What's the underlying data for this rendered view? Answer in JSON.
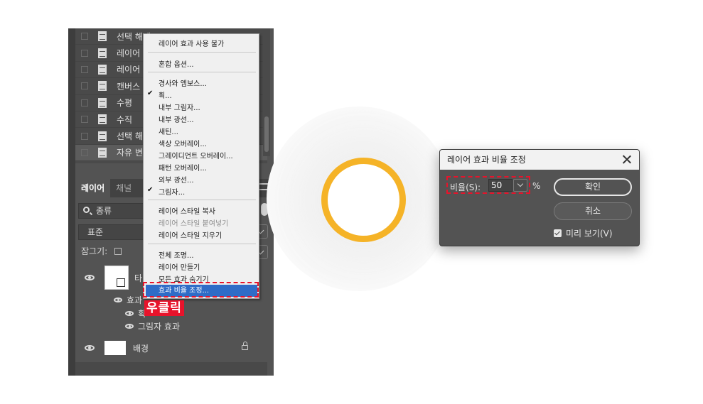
{
  "history": {
    "items": [
      "선택 해제",
      "레이어",
      "레이어",
      "캔버스",
      "수평",
      "수직",
      "선택 해",
      "자유 변"
    ]
  },
  "layers_panel": {
    "tabs": [
      "레이어",
      "채널"
    ],
    "search_label": "종류",
    "blend_mode": "표준",
    "lock_label": "잠그기:",
    "layers": [
      {
        "name": "타",
        "effects_label": "효과",
        "effects": [
          "획",
          "그림자 효과"
        ]
      },
      {
        "name": "배경"
      }
    ]
  },
  "context_menu": {
    "items": [
      {
        "label": "레이어 효과 사용 불가"
      },
      {
        "label": "혼합 옵션..."
      },
      {
        "label": "경사와 엠보스..."
      },
      {
        "label": "획...",
        "checked": true
      },
      {
        "label": "내부 그림자..."
      },
      {
        "label": "내부 광선..."
      },
      {
        "label": "새틴..."
      },
      {
        "label": "색상 오버레이..."
      },
      {
        "label": "그레이디언트 오버레이..."
      },
      {
        "label": "패턴 오버레이..."
      },
      {
        "label": "외부 광선..."
      },
      {
        "label": "그림자...",
        "checked": true
      },
      {
        "label": "레이어 스타일 복사"
      },
      {
        "label": "레이어 스타일 붙여넣기",
        "disabled": true
      },
      {
        "label": "레이어 스타일 지우기"
      },
      {
        "label": "전체 조명..."
      },
      {
        "label": "레이어 만들기"
      },
      {
        "label": "모든 효과 숨기기"
      },
      {
        "label": "효과 비율 조정...",
        "selected": true
      }
    ],
    "check_mark": "✔"
  },
  "annotation": {
    "right_click": "우클릭",
    "color": "#e8132b"
  },
  "dialog": {
    "title": "레이어 효과 비율 조정",
    "scale_label": "비율(S):",
    "scale_value": "50",
    "scale_unit": "%",
    "ok_label": "확인",
    "cancel_label": "취소",
    "preview_label": "미리 보기(V)",
    "preview_checked": true
  },
  "colors": {
    "accent_logo": "#f5b327",
    "menu_highlight": "#2f6cc7",
    "panel_bg": "#535353"
  }
}
